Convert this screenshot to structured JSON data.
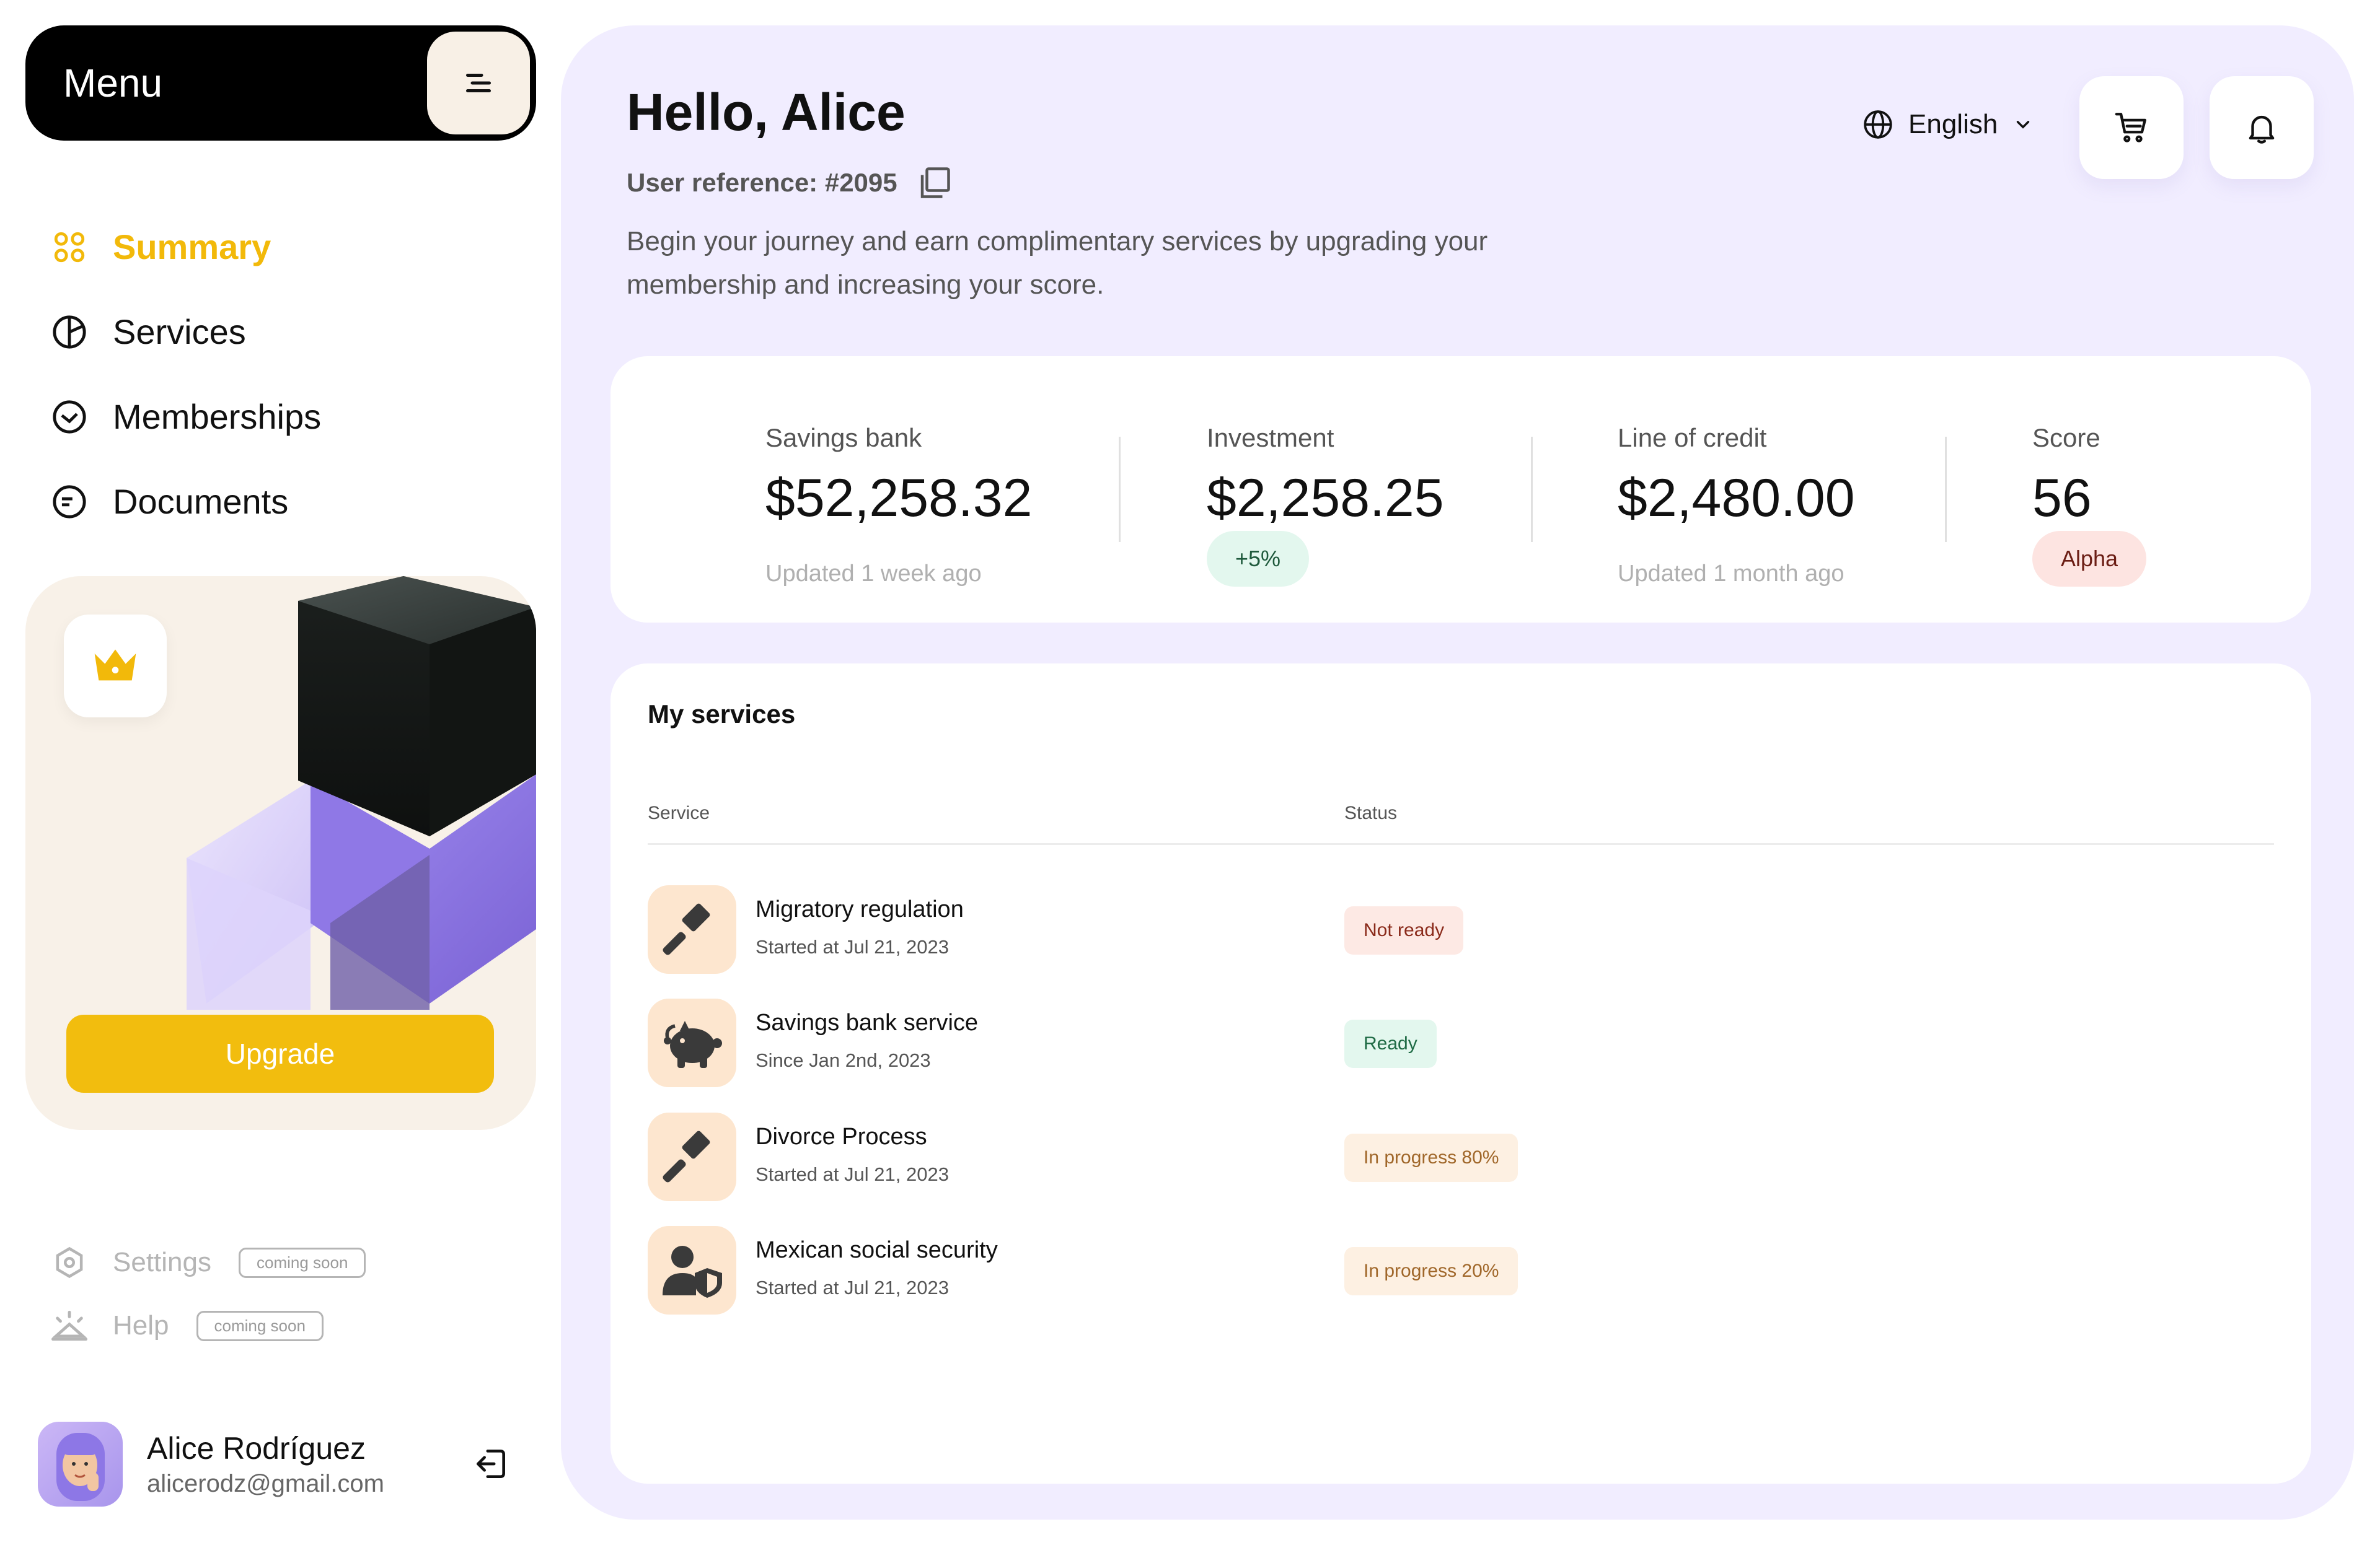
{
  "sidebar": {
    "menu_title": "Menu",
    "nav": [
      {
        "label": "Summary",
        "active": true
      },
      {
        "label": "Services",
        "active": false
      },
      {
        "label": "Memberships",
        "active": false
      },
      {
        "label": "Documents",
        "active": false
      }
    ],
    "upgrade_label": "Upgrade",
    "utilities": [
      {
        "label": "Settings",
        "badge": "coming soon"
      },
      {
        "label": "Help",
        "badge": "coming soon"
      }
    ],
    "user": {
      "name": "Alice Rodríguez",
      "email": "alicerodz@gmail.com"
    }
  },
  "header": {
    "greeting": "Hello, Alice",
    "user_reference": "User reference: #2095",
    "description": "Begin your journey and earn complimentary services by upgrading your membership and increasing your score.",
    "language": "English"
  },
  "stats": [
    {
      "label": "Savings bank",
      "value": "$52,258.32",
      "sub": "Updated 1 week ago"
    },
    {
      "label": "Investment",
      "value": "$2,258.25",
      "chip": "+5%"
    },
    {
      "label": "Line of credit",
      "value": "$2,480.00",
      "sub": "Updated 1 month ago"
    },
    {
      "label": "Score",
      "value": "56",
      "chip": "Alpha"
    }
  ],
  "services": {
    "title": "My services",
    "columns": [
      "Service",
      "Status"
    ],
    "rows": [
      {
        "name": "Migratory regulation",
        "date": "Started at Jul 21, 2023",
        "status": "Not ready",
        "icon": "gavel-icon"
      },
      {
        "name": "Savings bank service",
        "date": "Since Jan 2nd, 2023",
        "status": "Ready",
        "icon": "piggy-bank-icon"
      },
      {
        "name": "Divorce Process",
        "date": "Started at Jul 21, 2023",
        "status": "In progress 80%",
        "icon": "gavel-icon"
      },
      {
        "name": "Mexican social security",
        "date": "Started at Jul 21, 2023",
        "status": "In progress 20%",
        "icon": "user-shield-icon"
      }
    ]
  },
  "colors": {
    "accent": "#f2b90a",
    "menu_bg": "#000000",
    "main_bg": "#f1edff",
    "status_not_ready_bg": "#fde9e4",
    "status_not_ready_fg": "#8a2a1a",
    "status_ready_bg": "#e3f7ee",
    "status_ready_fg": "#1f6b45",
    "status_progress_bg": "#fdf0e2",
    "status_progress_fg": "#a0672a"
  }
}
